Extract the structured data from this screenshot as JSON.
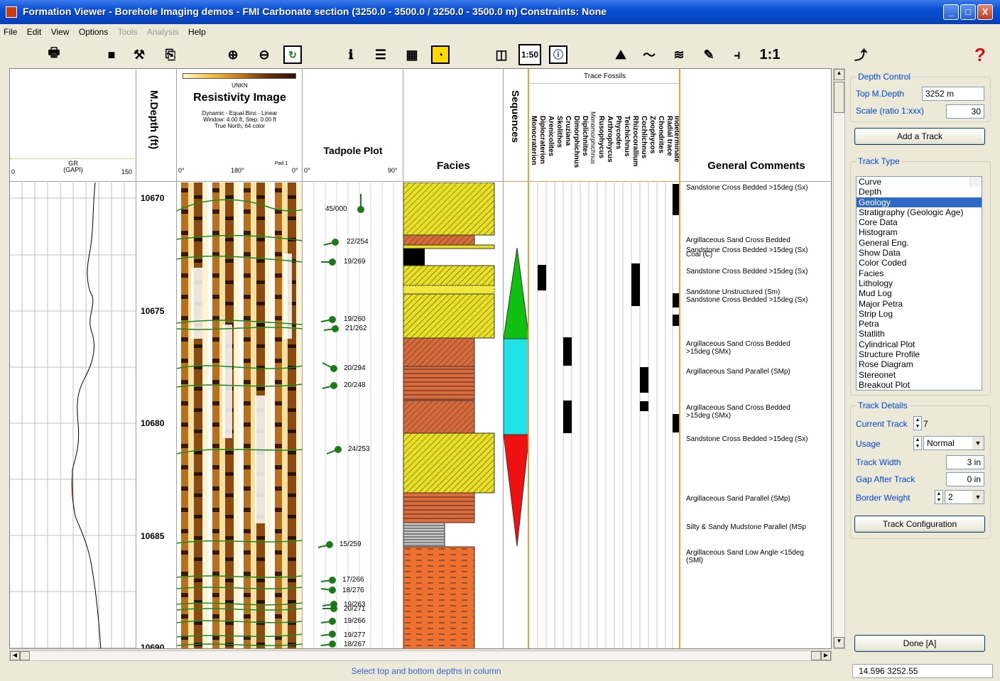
{
  "window": {
    "title": "Formation Viewer - Borehole Imaging demos - FMI Carbonate section (3250.0 - 3500.0 / 3250.0 - 3500.0 m) Constraints:  None",
    "minimize": "_",
    "maximize": "□",
    "close": "X"
  },
  "menu": [
    "File",
    "Edit",
    "View",
    "Options",
    "Tools",
    "Analysis",
    "Help"
  ],
  "toolbar": {
    "scale_btn": "1:50",
    "one_to_one": "1:1"
  },
  "tracks": {
    "gr": {
      "name": "GR",
      "unit": "(GAPI)",
      "min": "0",
      "max": "150"
    },
    "depth": {
      "title": "M.Depth (ft)",
      "labels": [
        "10670",
        "10675",
        "10680",
        "10685",
        "10690"
      ]
    },
    "resistivity": {
      "scale_label": "UNKN",
      "title": "Resistivity Image",
      "info1": "Dynamic - Equal Bins - Linear",
      "info2": "Window: 4.00 ft, Step: 0.00 ft",
      "info3": "True North, 64 color",
      "ax0": "0°",
      "ax180": "180°",
      "pad": "Pad 1",
      "ax360": "0°"
    },
    "tadpole": {
      "title": "Tadpole Plot",
      "ax0": "0°",
      "ax90": "90°",
      "labels": [
        "45/000",
        "22/254",
        "19/269",
        "19/260",
        "21/262",
        "20/294",
        "20/248",
        "24/253",
        "15/259",
        "17/266",
        "18/276",
        "19/263",
        "20/271",
        "19/266",
        "19/277",
        "18/267"
      ]
    },
    "facies": {
      "title": "Facies"
    },
    "sequences": {
      "title": "Sequences"
    },
    "trace_fossils": {
      "title": "Trace Fossils",
      "columns": [
        "Monocraterion",
        "Diplocraterion",
        "Arenicolites",
        "Skolithos",
        "Cruziana",
        "Dimorphichnus",
        "Diplichnites",
        "Monomorphichnus",
        "Rusophycus",
        "Arthrophycus",
        "Phycodes",
        "Teichichnus",
        "Rhizocorallium",
        "Cochlichnus",
        "Zoophycos",
        "Chondrites",
        "Radial trace",
        "Indeterminate"
      ]
    },
    "comments": {
      "title": "General Comments",
      "items": [
        "Sandstone Cross Bedded >15deg (Sx)",
        "Argillaceous Sand Cross Bedded",
        "Sandstone Cross Bedded >15deg (Sx)",
        "Coal (C)",
        "Sandstone Cross Bedded >15deg (Sx)",
        "Sandstone Unstructured (Sm)",
        "Sandstone Cross Bedded >15deg (Sx)",
        "Argillaceous Sand Cross Bedded",
        ">15deg (SMx)",
        "Argillaceous Sand Parallel (SMp)",
        "Argillaceous Sand Cross Bedded",
        ">15deg (SMx)",
        "Sandstone Cross Bedded >15deg (Sx)",
        "Argillaceous Sand Parallel (SMp)",
        "Silty & Sandy Mudstone Parallel (MSp",
        "Argillaceous Sand Low Angle <15deg",
        "(SMl)"
      ]
    }
  },
  "panel": {
    "depth_control": "Depth Control",
    "top_depth_label": "Top M.Depth",
    "top_depth_value": "3252 m",
    "scale_label": "Scale (ratio 1:xxx)",
    "scale_value": "30",
    "add_track": "Add a Track",
    "track_type": "Track Type",
    "track_types": [
      "Curve",
      "Depth",
      "Geology",
      "Stratigraphy (Geologic Age)",
      "Core Data",
      "Histogram",
      "General Eng.",
      "Show Data",
      "Color Coded",
      "Facies",
      "Lithology",
      "Mud Log",
      "Major Petra",
      "Strip Log",
      "Petra",
      "Statlith",
      "Cylindrical Plot",
      "Structure Profile",
      "Rose Diagram",
      "Stereonet",
      "Breakout Plot"
    ],
    "selected_track_type": "Geology",
    "track_details": "Track Details",
    "current_track_label": "Current Track",
    "current_track_value": "7",
    "usage_label": "Usage",
    "usage_value": "Normal",
    "track_width_label": "Track Width",
    "track_width_value": "3 in",
    "gap_label": "Gap After Track",
    "gap_value": "0 in",
    "border_label": "Border Weight",
    "border_value": "2",
    "track_config": "Track Configuration",
    "done": "Done [A]"
  },
  "status": {
    "message": "Select top and bottom depths in column",
    "coords": "14.596  3252.55"
  }
}
